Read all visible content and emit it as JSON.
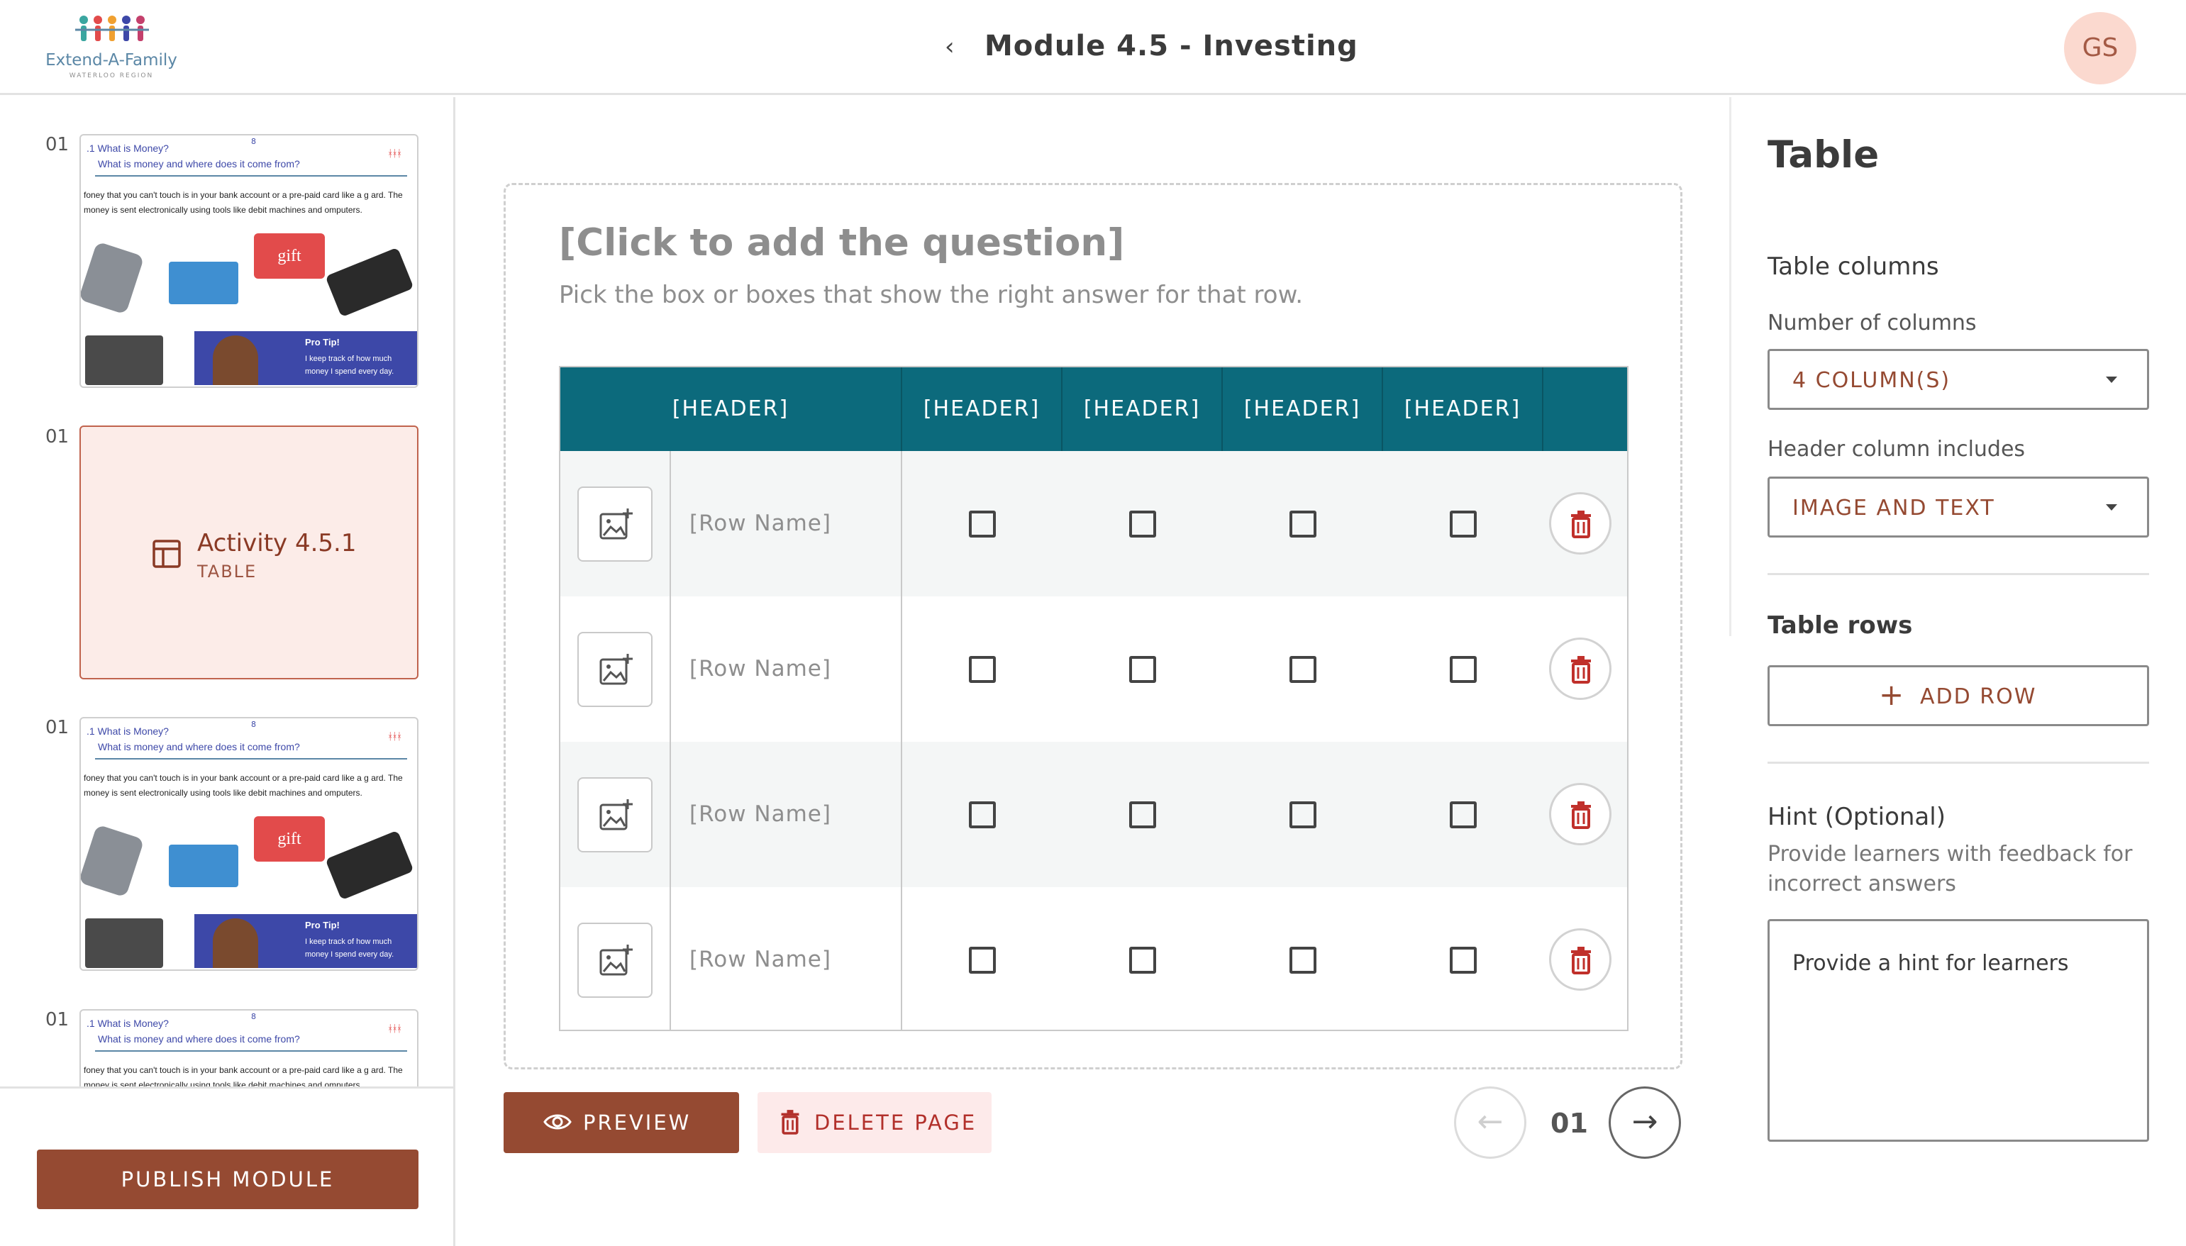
{
  "app": {
    "logo_text": "Extend-A-Family",
    "logo_sub": "WATERLOO REGION"
  },
  "header": {
    "title": "Module 4.5 - Investing",
    "avatar_initials": "GS"
  },
  "sidebar": {
    "pages": [
      {
        "num": "01",
        "kind": "lesson",
        "title": ".1 What is Money?",
        "subtitle": "What is money and where does it come from?",
        "marker": "8",
        "body": "foney that you can't touch is in your bank account or a pre-paid card like a g ard. The money is sent electronically using tools like debit machines and omputers.",
        "gift_label": "gift",
        "tip_title": "Pro Tip!",
        "tip_body": "I keep track of how much money I spend every day."
      },
      {
        "num": "01",
        "kind": "activity",
        "title": "Activity 4.5.1",
        "subtitle": "TABLE"
      },
      {
        "num": "01",
        "kind": "lesson",
        "title": ".1 What is Money?",
        "subtitle": "What is money and where does it come from?",
        "marker": "8",
        "body": "foney that you can't touch is in your bank account or a pre-paid card like a g ard. The money is sent electronically using tools like debit machines and omputers.",
        "gift_label": "gift",
        "tip_title": "Pro Tip!",
        "tip_body": "I keep track of how much money I spend every day."
      },
      {
        "num": "01",
        "kind": "lesson",
        "title": ".1 What is Money?",
        "subtitle": "What is money and where does it come from?",
        "marker": "8",
        "body": "foney that you can't touch is in your bank account or a pre-paid card like a g ard. The money is sent electronically using tools like debit machines and omputers."
      }
    ],
    "publish_label": "PUBLISH MODULE"
  },
  "editor": {
    "question_placeholder": "[Click to add the question]",
    "instructions": "Pick the box or boxes that show the right answer for that row.",
    "table": {
      "headers": [
        "[HEADER]",
        "[HEADER]",
        "[HEADER]",
        "[HEADER]",
        "[HEADER]"
      ],
      "rows": [
        {
          "name": "[Row Name]",
          "checked": [
            false,
            false,
            false,
            false
          ]
        },
        {
          "name": "[Row Name]",
          "checked": [
            false,
            false,
            false,
            false
          ]
        },
        {
          "name": "[Row Name]",
          "checked": [
            false,
            false,
            false,
            false
          ]
        },
        {
          "name": "[Row Name]",
          "checked": [
            false,
            false,
            false,
            false
          ]
        }
      ]
    },
    "preview_label": "PREVIEW",
    "delete_label": "DELETE PAGE",
    "page_number": "01",
    "prev_arrow": "←",
    "next_arrow": "→"
  },
  "panel": {
    "title": "Table",
    "columns_heading": "Table columns",
    "num_columns_label": "Number of columns",
    "num_columns_value": "4 COLUMN(S)",
    "header_includes_label": "Header column includes",
    "header_includes_value": "IMAGE AND TEXT",
    "rows_heading": "Table rows",
    "add_row_label": "ADD ROW",
    "hint_heading": "Hint (Optional)",
    "hint_help": "Provide learners with feedback for incorrect answers",
    "hint_placeholder": "Provide a hint for learners"
  },
  "colors": {
    "brand": "#954a32",
    "table_header": "#0c6a7c",
    "active_page_bg": "#fcece8",
    "delete_red": "#b2302b",
    "avatar_bg": "#fbd9cf"
  }
}
